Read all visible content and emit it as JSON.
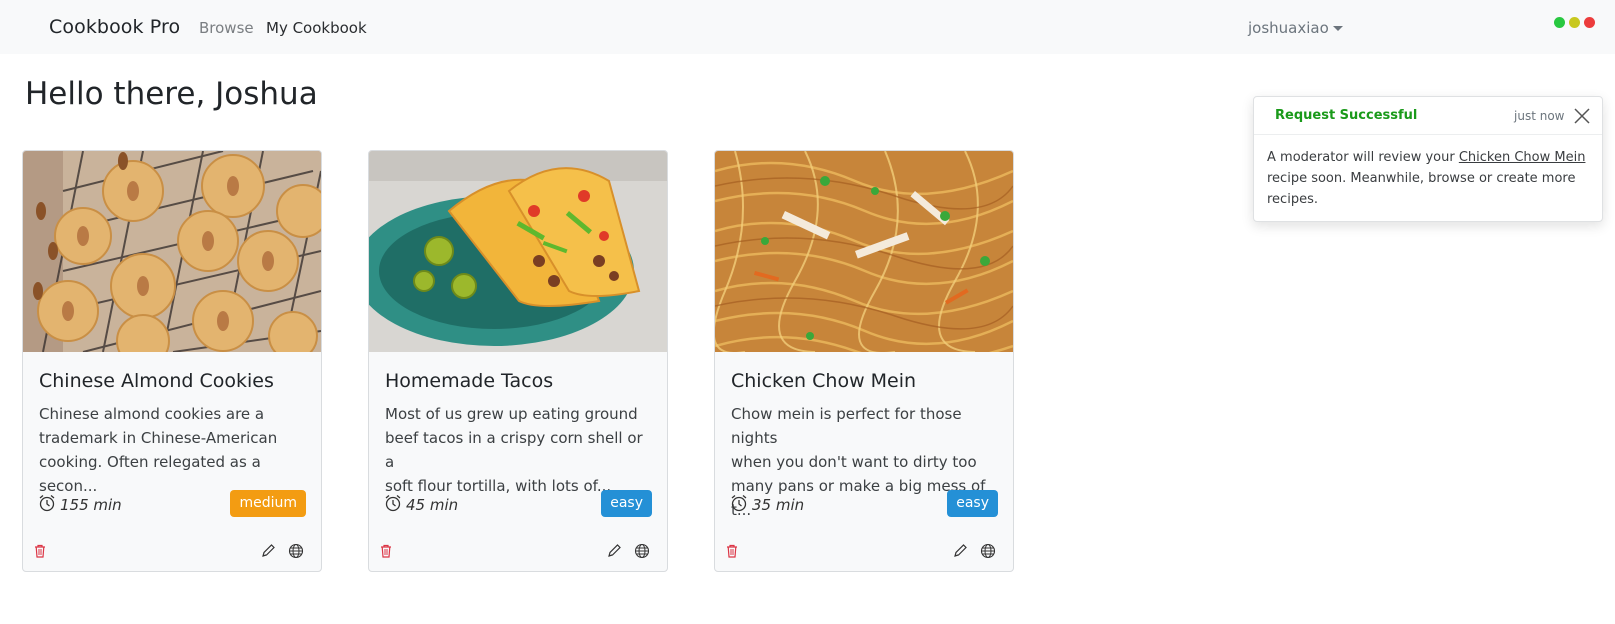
{
  "navbar": {
    "brand": "Cookbook Pro",
    "links": [
      "Browse",
      "My Cookbook"
    ],
    "user": "joshuaxiao",
    "window_dots": [
      "#28c840",
      "#c8c81e",
      "#ec3c3c"
    ]
  },
  "page": {
    "greeting": "Hello there, Joshua"
  },
  "recipes": [
    {
      "title": "Chinese Almond Cookies",
      "desc_lines": [
        "Chinese almond cookies are a",
        "trademark in Chinese-American",
        "cooking. Often relegated as a secon..."
      ],
      "time": "155 min",
      "difficulty": "medium",
      "difficulty_color": "#f39c12",
      "image_icon": "almond-cookies-image"
    },
    {
      "title": "Homemade Tacos",
      "desc_lines": [
        "Most of us grew up eating ground",
        "beef tacos in a crispy corn shell or a",
        "soft flour tortilla, with lots of..."
      ],
      "time": "45 min",
      "difficulty": "easy",
      "difficulty_color": "#2490d6",
      "image_icon": "tacos-image"
    },
    {
      "title": "Chicken Chow Mein",
      "desc_lines": [
        "Chow mein is perfect for those nights",
        "when you don't want to dirty too",
        "many pans or make a big mess of t..."
      ],
      "time": "35 min",
      "difficulty": "easy",
      "difficulty_color": "#2490d6",
      "image_icon": "chow-mein-image"
    }
  ],
  "toast": {
    "title": "Request Successful",
    "time": "just now",
    "body_prefix": "A moderator will review your",
    "link": "Chicken Chow Mein",
    "body_line2": "recipe soon. Meanwhile, browse or create more",
    "body_line3": "recipes."
  },
  "colors": {
    "success": "#1a9a1a",
    "delete": "#dc3545"
  }
}
